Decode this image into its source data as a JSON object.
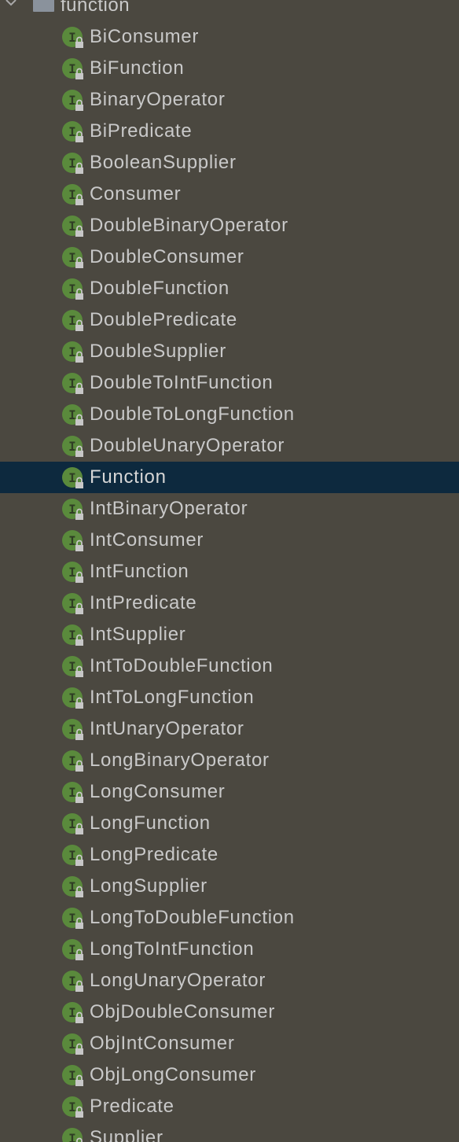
{
  "package": {
    "label": "function",
    "expanded": true
  },
  "item_icon": "interface-icon",
  "lock_badge": "lock-icon",
  "colors": {
    "background": "#4b4840",
    "selection": "#0d293e",
    "interface_green": "#5a8a3c",
    "text": "#c9c9c9"
  },
  "items": [
    {
      "label": "BiConsumer"
    },
    {
      "label": "BiFunction"
    },
    {
      "label": "BinaryOperator"
    },
    {
      "label": "BiPredicate"
    },
    {
      "label": "BooleanSupplier"
    },
    {
      "label": "Consumer"
    },
    {
      "label": "DoubleBinaryOperator"
    },
    {
      "label": "DoubleConsumer"
    },
    {
      "label": "DoubleFunction"
    },
    {
      "label": "DoublePredicate"
    },
    {
      "label": "DoubleSupplier"
    },
    {
      "label": "DoubleToIntFunction"
    },
    {
      "label": "DoubleToLongFunction"
    },
    {
      "label": "DoubleUnaryOperator"
    },
    {
      "label": "Function",
      "selected": true
    },
    {
      "label": "IntBinaryOperator"
    },
    {
      "label": "IntConsumer"
    },
    {
      "label": "IntFunction"
    },
    {
      "label": "IntPredicate"
    },
    {
      "label": "IntSupplier"
    },
    {
      "label": "IntToDoubleFunction"
    },
    {
      "label": "IntToLongFunction"
    },
    {
      "label": "IntUnaryOperator"
    },
    {
      "label": "LongBinaryOperator"
    },
    {
      "label": "LongConsumer"
    },
    {
      "label": "LongFunction"
    },
    {
      "label": "LongPredicate"
    },
    {
      "label": "LongSupplier"
    },
    {
      "label": "LongToDoubleFunction"
    },
    {
      "label": "LongToIntFunction"
    },
    {
      "label": "LongUnaryOperator"
    },
    {
      "label": "ObjDoubleConsumer"
    },
    {
      "label": "ObjIntConsumer"
    },
    {
      "label": "ObjLongConsumer"
    },
    {
      "label": "Predicate"
    },
    {
      "label": "Supplier"
    }
  ]
}
